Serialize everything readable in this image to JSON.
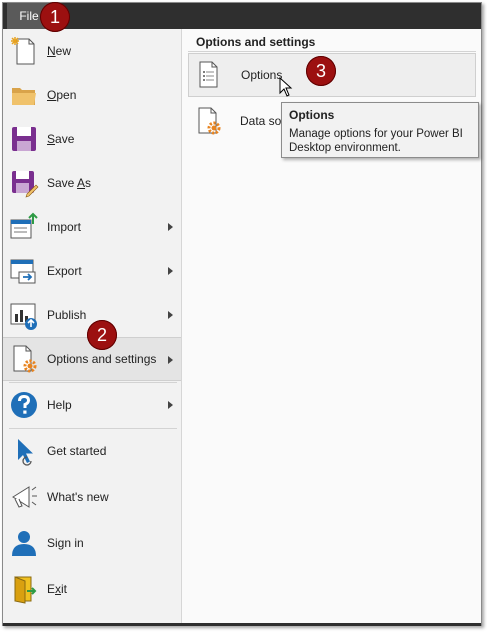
{
  "titlebar": {
    "file_label": "File"
  },
  "badges": [
    "1",
    "2",
    "3"
  ],
  "menu": {
    "items": [
      {
        "id": "new",
        "label": "New",
        "mnemonic": "N",
        "rest": "ew",
        "icon": "new-document-icon",
        "submenu": false
      },
      {
        "id": "open",
        "label": "Open",
        "mnemonic": "O",
        "rest": "pen",
        "icon": "folder-icon",
        "submenu": false
      },
      {
        "id": "save",
        "label": "Save",
        "mnemonic": "S",
        "rest": "ave",
        "icon": "floppy-disk-icon",
        "submenu": false
      },
      {
        "id": "save-as",
        "label": "Save As",
        "prefix": "Save ",
        "mnemonic": "A",
        "rest": "s",
        "icon": "floppy-disk-pencil-icon",
        "submenu": false
      },
      {
        "id": "import",
        "label": "Import",
        "icon": "import-icon",
        "submenu": true
      },
      {
        "id": "export",
        "label": "Export",
        "icon": "export-icon",
        "submenu": true
      },
      {
        "id": "publish",
        "label": "Publish",
        "icon": "publish-icon",
        "submenu": true
      },
      {
        "id": "options-and-settings",
        "label": "Options and settings",
        "icon": "document-gear-icon",
        "submenu": true,
        "selected": true
      },
      {
        "id": "help",
        "label": "Help",
        "icon": "help-question-icon",
        "submenu": true
      },
      {
        "id": "get-started",
        "label": "Get started",
        "icon": "get-started-icon",
        "submenu": false
      },
      {
        "id": "whats-new",
        "label": "What's new",
        "icon": "megaphone-icon",
        "submenu": false
      },
      {
        "id": "sign-in",
        "label": "Sign in",
        "icon": "user-icon",
        "submenu": false
      },
      {
        "id": "exit",
        "label": "Exit",
        "mnemonic": "x",
        "prefix": "E",
        "rest": "it",
        "icon": "exit-icon",
        "submenu": false
      }
    ]
  },
  "submenu": {
    "title": "Options and settings",
    "items": [
      {
        "id": "options",
        "label": "Options",
        "icon": "document-list-icon",
        "hover": true
      },
      {
        "id": "data-source-settings",
        "label": "Data sou",
        "icon": "document-gear-icon",
        "hover": false
      }
    ]
  },
  "tooltip": {
    "title": "Options",
    "body": "Manage options for your Power BI Desktop environment."
  },
  "colors": {
    "titlebar": "#2f2f2f",
    "badge": "#9c1010",
    "accent_orange": "#e8831e",
    "accent_purple": "#7a2f8f",
    "accent_blue": "#1f6fb8"
  }
}
